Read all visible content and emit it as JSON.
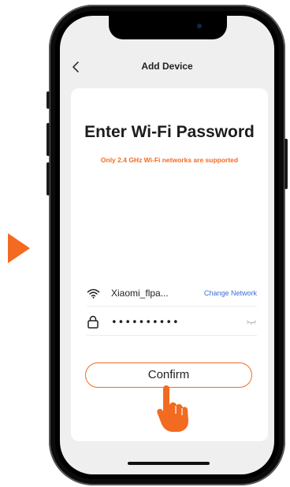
{
  "header": {
    "title": "Add Device"
  },
  "card": {
    "title": "Enter Wi-Fi Password",
    "subtitle": "Only 2.4 GHz Wi-Fi networks are supported"
  },
  "network": {
    "ssid": "Xiaomi_flpa...",
    "change_label": "Change Network"
  },
  "password": {
    "value": "••••••••••"
  },
  "confirm": {
    "label": "Confirm"
  },
  "colors": {
    "accent": "#f26b21",
    "link": "#3a6fd8",
    "screen_bg": "#efefef",
    "card_bg": "#ffffff"
  },
  "icons": [
    "play-arrow-icon",
    "back-chevron-icon",
    "wifi-icon",
    "lock-icon",
    "eye-off-icon",
    "tap-hand-icon"
  ]
}
